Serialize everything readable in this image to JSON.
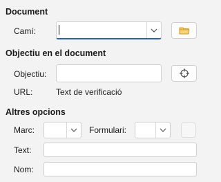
{
  "document": {
    "heading": "Document",
    "path_label": "Camí:",
    "path_value": ""
  },
  "target": {
    "heading": "Objectiu en el document",
    "target_label": "Objectiu:",
    "target_value": "",
    "url_label": "URL:",
    "url_value": "Text de verificació"
  },
  "other": {
    "heading": "Altres opcions",
    "frame_label": "Marc:",
    "frame_value": "",
    "form_label": "Formulari:",
    "form_value": "",
    "text_label": "Text:",
    "text_value": "",
    "name_label": "Nom:",
    "name_value": ""
  },
  "colors": {
    "accent": "#1f62c9",
    "folder": "#f0a000"
  }
}
